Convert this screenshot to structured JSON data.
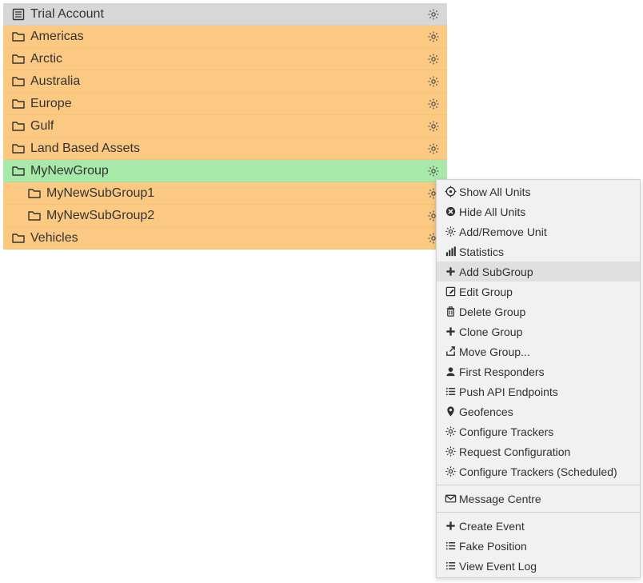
{
  "tree": {
    "root": {
      "label": "Trial Account",
      "icon": "list"
    },
    "items": [
      {
        "label": "Americas",
        "indent": 0,
        "style": "orange"
      },
      {
        "label": "Arctic",
        "indent": 0,
        "style": "orange"
      },
      {
        "label": "Australia",
        "indent": 0,
        "style": "orange"
      },
      {
        "label": "Europe",
        "indent": 0,
        "style": "orange"
      },
      {
        "label": "Gulf",
        "indent": 0,
        "style": "orange"
      },
      {
        "label": "Land Based Assets",
        "indent": 0,
        "style": "orange"
      },
      {
        "label": "MyNewGroup",
        "indent": 0,
        "style": "green"
      },
      {
        "label": "MyNewSubGroup1",
        "indent": 1,
        "style": "orange"
      },
      {
        "label": "MyNewSubGroup2",
        "indent": 1,
        "style": "orange"
      },
      {
        "label": "Vehicles",
        "indent": 0,
        "style": "orange"
      }
    ]
  },
  "menu": {
    "groups": [
      [
        {
          "icon": "target",
          "label": "Show All Units"
        },
        {
          "icon": "close-circle",
          "label": "Hide All Units"
        },
        {
          "icon": "gear",
          "label": "Add/Remove Unit"
        },
        {
          "icon": "bars",
          "label": "Statistics"
        },
        {
          "icon": "plus",
          "label": "Add SubGroup",
          "hover": true
        },
        {
          "icon": "edit",
          "label": "Edit Group"
        },
        {
          "icon": "trash",
          "label": "Delete Group"
        },
        {
          "icon": "plus",
          "label": "Clone Group"
        },
        {
          "icon": "share",
          "label": "Move Group..."
        },
        {
          "icon": "person",
          "label": "First Responders"
        },
        {
          "icon": "menu",
          "label": "Push API Endpoints"
        },
        {
          "icon": "pin",
          "label": "Geofences"
        },
        {
          "icon": "gear",
          "label": "Configure Trackers"
        },
        {
          "icon": "gear",
          "label": "Request Configuration"
        },
        {
          "icon": "gear",
          "label": "Configure Trackers (Scheduled)"
        }
      ],
      [
        {
          "icon": "mail",
          "label": "Message Centre"
        }
      ],
      [
        {
          "icon": "plus",
          "label": "Create Event"
        },
        {
          "icon": "menu",
          "label": "Fake Position"
        },
        {
          "icon": "menu",
          "label": "View Event Log"
        }
      ]
    ]
  }
}
